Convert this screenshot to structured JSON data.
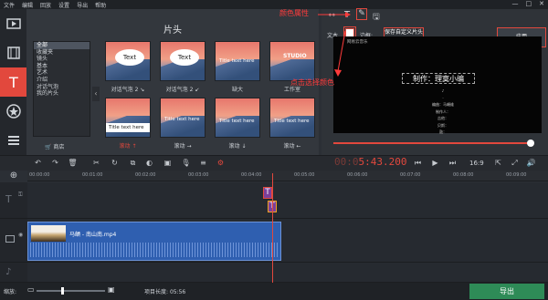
{
  "menu": [
    "文件",
    "编辑",
    "回放",
    "设置",
    "导出",
    "帮助"
  ],
  "window_controls": [
    "—",
    "□",
    "✕"
  ],
  "panel": {
    "title": "片头",
    "categories": [
      "全部",
      "收藏夹",
      "镜头",
      "基本",
      "艺术",
      "介绍",
      "对话气泡",
      "我的片头"
    ],
    "store_label": "商店",
    "thumbs": [
      {
        "caption": "Text",
        "label": "对话气泡 2 ↘",
        "kind": "bubble"
      },
      {
        "caption": "Text",
        "label": "对话气泡 2 ↙",
        "kind": "bubble"
      },
      {
        "caption": "Title text here",
        "label": "缺大",
        "kind": "title"
      },
      {
        "caption": "STUDIO",
        "label": "工作室",
        "kind": "studio"
      },
      {
        "caption": "Title text here",
        "label": "滚动 ↑",
        "kind": "band",
        "highlight": true
      },
      {
        "caption": "Title text here",
        "label": "滚动 →",
        "kind": "title"
      },
      {
        "caption": "Title text here",
        "label": "滚动 ↓",
        "kind": "title"
      },
      {
        "caption": "Title text here",
        "label": "滚动 ←",
        "kind": "title"
      }
    ]
  },
  "props": {
    "text_label": "文本",
    "border_label": "边框:",
    "customize_label": "保存自定义片头",
    "apply_label": "应用",
    "preview_logo": "网易云音乐",
    "preview_main": "制作：理寞小编",
    "credits": [
      "♪",
      "·",
      "编曲：马頔维",
      "制作人：",
      "吉他：",
      "贝斯：",
      "鼓：",
      "和声：",
      "录音："
    ]
  },
  "playback": {
    "timecode_dim": "00:0",
    "timecode": "5:43.200",
    "ratio": "16:9"
  },
  "ruler": [
    "00:00:00",
    "00:01:00",
    "00:02:00",
    "00:03:00",
    "00:04:00",
    "00:05:00",
    "00:06:00",
    "00:07:00",
    "00:08:00",
    "00:09:00"
  ],
  "clip": {
    "name": "马頔 - 南山南.mp4"
  },
  "footer": {
    "zoom_label": "缩放:",
    "duration_label": "项目长度:",
    "duration": "05:56",
    "export_label": "导出"
  },
  "annotations": {
    "color_property": "颜色属性",
    "click_select_color": "点击选择颜色"
  },
  "colors": {
    "accent": "#e2483d",
    "export": "#2e8b57",
    "clip": "#2f5fb0"
  }
}
